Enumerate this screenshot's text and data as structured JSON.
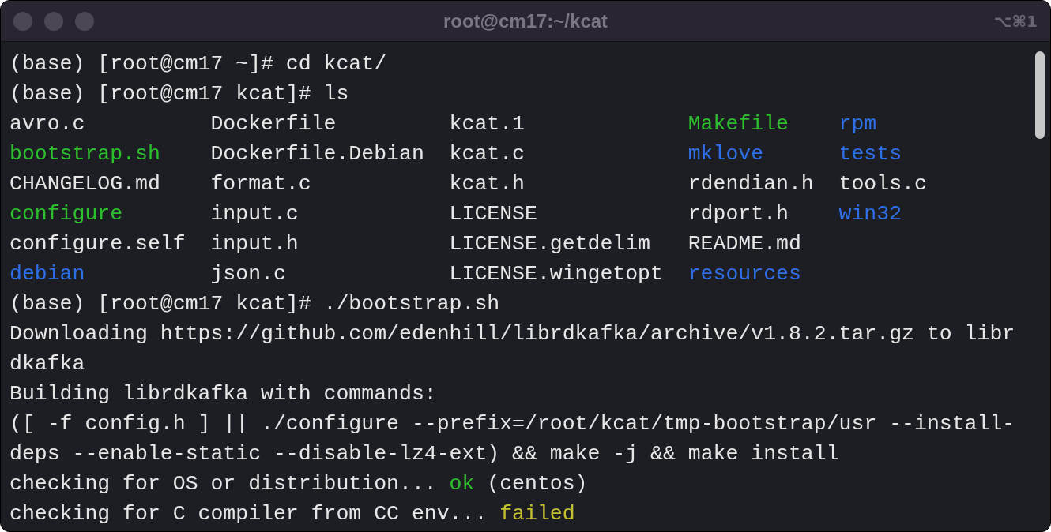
{
  "window": {
    "title": "root@cm17:~/kcat",
    "shortcut": "⌥⌘1"
  },
  "terminal": {
    "lines_before": [
      {
        "segments": [
          {
            "text": "(base) [root@cm17 ~]# cd kcat/"
          }
        ]
      },
      {
        "segments": [
          {
            "text": "(base) [root@cm17 kcat]# ls"
          }
        ]
      }
    ],
    "listing": {
      "rows": [
        [
          {
            "text": "avro.c"
          },
          {
            "text": "Dockerfile"
          },
          {
            "text": "kcat.1"
          },
          {
            "text": "Makefile",
            "color": "#2dbf2d"
          },
          {
            "text": "rpm",
            "color": "#2f6fe6"
          }
        ],
        [
          {
            "text": "bootstrap.sh",
            "color": "#2dbf2d"
          },
          {
            "text": "Dockerfile.Debian"
          },
          {
            "text": "kcat.c"
          },
          {
            "text": "mklove",
            "color": "#2f6fe6"
          },
          {
            "text": "tests",
            "color": "#2f6fe6"
          }
        ],
        [
          {
            "text": "CHANGELOG.md"
          },
          {
            "text": "format.c"
          },
          {
            "text": "kcat.h"
          },
          {
            "text": "rdendian.h"
          },
          {
            "text": "tools.c"
          }
        ],
        [
          {
            "text": "configure",
            "color": "#2dbf2d"
          },
          {
            "text": "input.c"
          },
          {
            "text": "LICENSE"
          },
          {
            "text": "rdport.h"
          },
          {
            "text": "win32",
            "color": "#2f6fe6"
          }
        ],
        [
          {
            "text": "configure.self"
          },
          {
            "text": "input.h"
          },
          {
            "text": "LICENSE.getdelim"
          },
          {
            "text": "README.md"
          }
        ],
        [
          {
            "text": "debian",
            "color": "#2f6fe6"
          },
          {
            "text": "json.c"
          },
          {
            "text": "LICENSE.wingetopt"
          },
          {
            "text": "resources",
            "color": "#2f6fe6"
          }
        ]
      ]
    },
    "lines_after": [
      {
        "segments": [
          {
            "text": "(base) [root@cm17 kcat]# ./bootstrap.sh"
          }
        ]
      },
      {
        "segments": [
          {
            "text": "Downloading https://github.com/edenhill/librdkafka/archive/v1.8.2.tar.gz to libr"
          }
        ]
      },
      {
        "segments": [
          {
            "text": "dkafka"
          }
        ]
      },
      {
        "segments": [
          {
            "text": "Building librdkafka with commands:"
          }
        ]
      },
      {
        "segments": [
          {
            "text": "([ -f config.h ] || ./configure --prefix=/root/kcat/tmp-bootstrap/usr --install-"
          }
        ]
      },
      {
        "segments": [
          {
            "text": "deps --enable-static --disable-lz4-ext) && make -j && make install"
          }
        ]
      },
      {
        "segments": [
          {
            "text": "checking for OS or distribution..."
          },
          {
            "text": "ok",
            "color": "#2dbf2d"
          },
          {
            "text": "(centos)"
          }
        ]
      },
      {
        "segments": [
          {
            "text": "checking for C compiler from CC env..."
          },
          {
            "text": "failed",
            "color": "#c4c030"
          }
        ]
      }
    ]
  }
}
